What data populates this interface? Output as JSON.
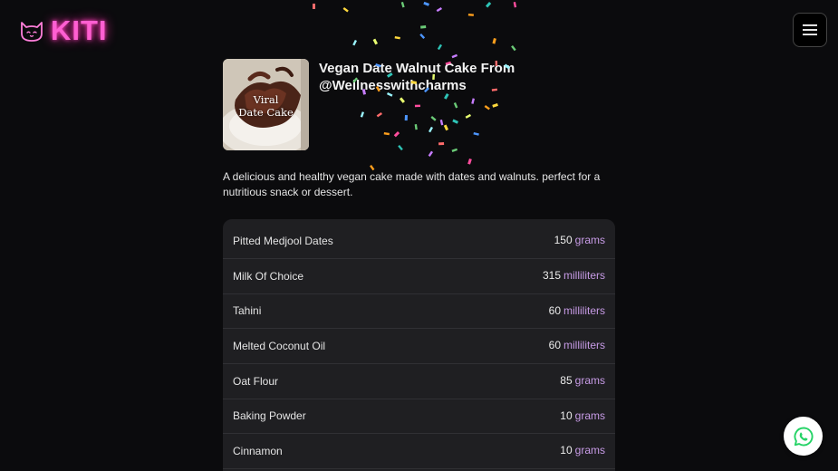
{
  "brand": {
    "name": "KITI",
    "accent_color": "#ff5fd2",
    "icon": "cat-face-icon"
  },
  "header": {
    "menu_icon": "hamburger-menu-icon"
  },
  "recipe": {
    "title": "Vegan Date Walnut Cake From @Wellnesswithcharms",
    "thumbnail_caption_line1": "Viral",
    "thumbnail_caption_line2": "Date Cake",
    "description": "A delicious and healthy vegan cake made with dates and walnuts. perfect for a nutritious snack or dessert."
  },
  "ingredients": [
    {
      "name": "Pitted Medjool Dates",
      "amount": "150",
      "unit": "grams"
    },
    {
      "name": "Milk Of Choice",
      "amount": "315",
      "unit": "milliliters"
    },
    {
      "name": "Tahini",
      "amount": "60",
      "unit": "milliliters"
    },
    {
      "name": "Melted Coconut Oil",
      "amount": "60",
      "unit": "milliliters"
    },
    {
      "name": "Oat Flour",
      "amount": "85",
      "unit": "grams"
    },
    {
      "name": "Baking Powder",
      "amount": "10",
      "unit": "grams"
    },
    {
      "name": "Cinnamon",
      "amount": "10",
      "unit": "grams"
    }
  ],
  "floating": {
    "whatsapp_icon": "whatsapp-icon",
    "whatsapp_color": "#25d366"
  },
  "unit_color": "#c79be6"
}
